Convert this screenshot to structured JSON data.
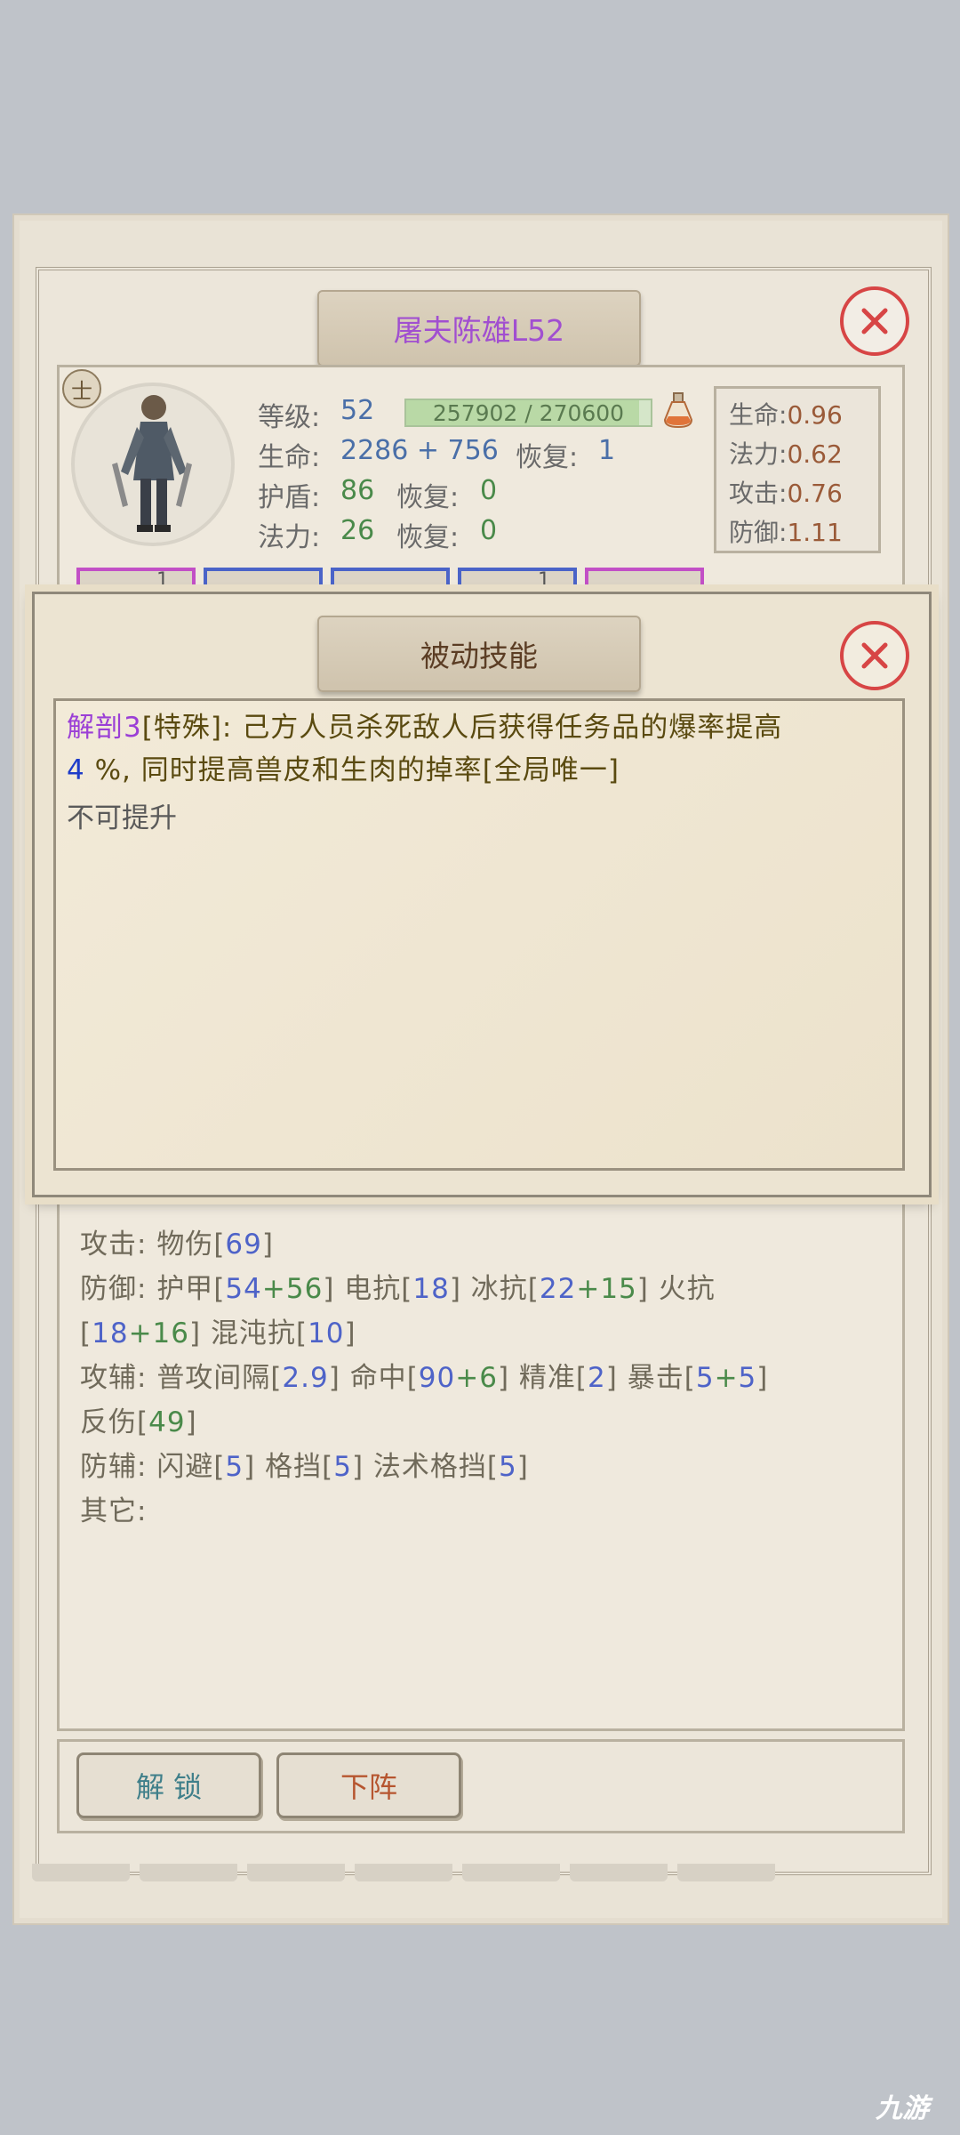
{
  "character": {
    "title": "屠夫陈雄L52",
    "class_badge": "士",
    "level_label": "等级:",
    "level": "52",
    "exp_text": "257902 / 270600",
    "exp_progress": 0.953,
    "hp_label": "生命:",
    "hp": "2286 + 756",
    "hp_regen_label": "恢复:",
    "hp_regen": "1",
    "shield_label": "护盾:",
    "shield": "86",
    "shield_regen_label": "恢复:",
    "shield_regen": "0",
    "mana_label": "法力:",
    "mana": "26",
    "mana_regen_label": "恢复:",
    "mana_regen": "0"
  },
  "ratios": [
    {
      "label": "生命:",
      "value": "0.96"
    },
    {
      "label": "法力:",
      "value": "0.62"
    },
    {
      "label": "攻击:",
      "value": "0.76"
    },
    {
      "label": "防御:",
      "value": "1.11"
    }
  ],
  "equipment": {
    "slots": [
      {
        "border": "#c24fc6",
        "badge": "1"
      },
      {
        "border": "#4a63c8",
        "badge": ""
      },
      {
        "border": "#4a63c8",
        "badge": ""
      },
      {
        "border": "#4a63c8",
        "badge": "1"
      },
      {
        "border": "#c24fc6",
        "badge": ""
      }
    ]
  },
  "attributes": {
    "attack_label": "攻击:",
    "attack_phys": "物伤",
    "attack_phys_value": "69",
    "defense_label": "防御:",
    "armor_label": "护甲",
    "armor_base": "54",
    "armor_bonus": "56",
    "elec_label": "电抗",
    "elec": "18",
    "ice_label": "冰抗",
    "ice_base": "22",
    "ice_bonus": "15",
    "fire_label": "火抗",
    "fire_base": "18",
    "fire_bonus": "16",
    "chaos_label": "混沌抗",
    "chaos": "10",
    "atk_aux_label": "攻辅:",
    "atk_interval_label": "普攻间隔",
    "atk_interval": "2.9",
    "hit_label": "命中",
    "hit_base": "90",
    "hit_bonus": "6",
    "precision_label": "精准",
    "precision": "2",
    "crit_label": "暴击",
    "crit_base": "5",
    "crit_bonus": "5",
    "reflect_label": "反伤",
    "reflect": "49",
    "def_aux_label": "防辅:",
    "dodge_label": "闪避",
    "dodge": "5",
    "block_label": "格挡",
    "block": "5",
    "spell_block_label": "法术格挡",
    "spell_block": "5",
    "other_label": "其它:"
  },
  "buttons": {
    "unlock": "解 锁",
    "dismiss": "下阵"
  },
  "skill_dialog": {
    "title": "被动技能",
    "skill_name": "解剖3",
    "desc_part1": "[特殊]: 己方人员杀死敌人后获得任务品的爆率提高",
    "percent": "4",
    "desc_part2": " %, 同时提高兽皮和生肉的掉率[全局唯一]",
    "note": "不可提升"
  },
  "colors": {
    "close_red": "#d74545",
    "skill_name_purple": "#9b3fd6",
    "title_purple": "#a14fd0"
  },
  "icons": {
    "close": "close-icon",
    "potion": "potion-icon",
    "avatar": "character-portrait"
  },
  "watermark": "九游"
}
